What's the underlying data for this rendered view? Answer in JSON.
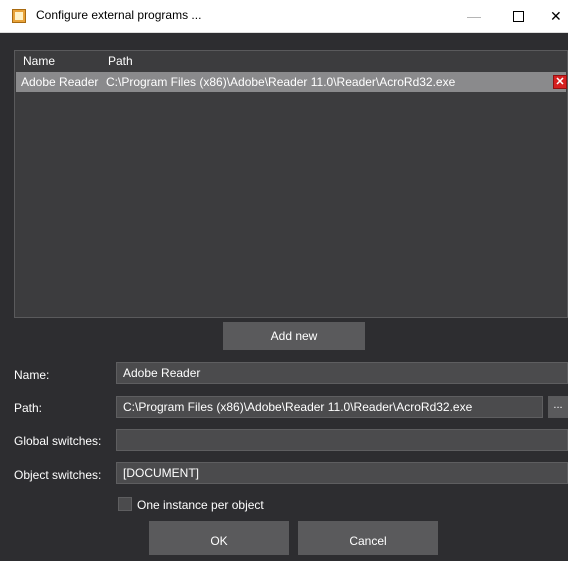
{
  "window": {
    "title": "Configure external programs ...",
    "minimize_glyph": "—",
    "close_glyph": "✕"
  },
  "list": {
    "columns": [
      "Name",
      "Path"
    ],
    "rows": [
      {
        "name": "Adobe Reader",
        "path": "C:\\Program Files (x86)\\Adobe\\Reader 11.0\\Reader\\AcroRd32.exe",
        "delete_glyph": "✕"
      }
    ]
  },
  "add_new_label": "Add new",
  "form": {
    "name_label": "Name:",
    "name_value": "Adobe Reader",
    "path_label": "Path:",
    "path_value": "C:\\Program Files (x86)\\Adobe\\Reader 11.0\\Reader\\AcroRd32.exe",
    "browse_label": "...",
    "global_switches_label": "Global switches:",
    "global_switches_value": "",
    "object_switches_label": "Object switches:",
    "object_switches_value": "[DOCUMENT]",
    "one_instance_label": "One instance per object",
    "one_instance_checked": false
  },
  "buttons": {
    "ok": "OK",
    "cancel": "Cancel"
  },
  "colors": {
    "background": "#2d2d30",
    "list_background": "#3c3c3e",
    "selected_row": "#8a8a8c",
    "button": "#5a5a5c",
    "field": "#4b4b4d",
    "delete_icon": "#d62020"
  }
}
